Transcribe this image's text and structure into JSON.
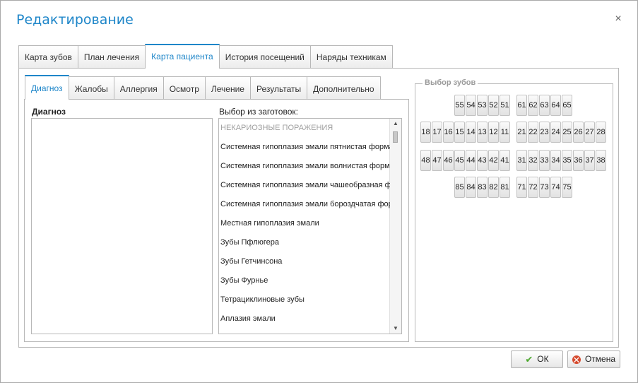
{
  "dialog": {
    "title": "Редактирование",
    "close_symbol": "×"
  },
  "outer_tabs": [
    {
      "label": "Карта зубов",
      "active": false
    },
    {
      "label": "План лечения",
      "active": false
    },
    {
      "label": "Карта пациента",
      "active": true
    },
    {
      "label": "История посещений",
      "active": false
    },
    {
      "label": "Наряды техникам",
      "active": false
    }
  ],
  "inner_tabs": [
    {
      "label": "Диагноз",
      "active": true
    },
    {
      "label": "Жалобы",
      "active": false
    },
    {
      "label": "Аллергия",
      "active": false
    },
    {
      "label": "Осмотр",
      "active": false
    },
    {
      "label": "Лечение",
      "active": false
    },
    {
      "label": "Результаты",
      "active": false
    },
    {
      "label": "Дополнительно",
      "active": false
    }
  ],
  "diagnosis": {
    "label": "Диагноз",
    "value": ""
  },
  "templates": {
    "label": "Выбор из заготовок:",
    "items": [
      {
        "text": "НЕКАРИОЗНЫЕ ПОРАЖЕНИЯ",
        "header": true
      },
      {
        "text": "Системная гипоплазия эмали пятнистая форма",
        "header": false
      },
      {
        "text": "Системная гипоплазия эмали волнистая форма",
        "header": false
      },
      {
        "text": "Системная гипоплазия эмали чашеобразная фо",
        "header": false
      },
      {
        "text": "Системная гипоплазия эмали бороздчатая фор",
        "header": false
      },
      {
        "text": "Местная гипоплазия эмали",
        "header": false
      },
      {
        "text": "Зубы Пфлюгера",
        "header": false
      },
      {
        "text": "Зубы Гетчинсона",
        "header": false
      },
      {
        "text": "Зубы Фурнье",
        "header": false
      },
      {
        "text": "Тетрациклиновые зубы",
        "header": false
      },
      {
        "text": "Аплазия эмали",
        "header": false
      }
    ]
  },
  "teeth": {
    "legend": "Выбор зубов",
    "upper_primary_right": [
      "55",
      "54",
      "53",
      "52",
      "51"
    ],
    "upper_primary_left": [
      "61",
      "62",
      "63",
      "64",
      "65"
    ],
    "upper_permanent_right": [
      "18",
      "17",
      "16",
      "15",
      "14",
      "13",
      "12",
      "11"
    ],
    "upper_permanent_left": [
      "21",
      "22",
      "23",
      "24",
      "25",
      "26",
      "27",
      "28"
    ],
    "lower_permanent_right": [
      "48",
      "47",
      "46",
      "45",
      "44",
      "43",
      "42",
      "41"
    ],
    "lower_permanent_left": [
      "31",
      "32",
      "33",
      "34",
      "35",
      "36",
      "37",
      "38"
    ],
    "lower_primary_right": [
      "85",
      "84",
      "83",
      "82",
      "81"
    ],
    "lower_primary_left": [
      "71",
      "72",
      "73",
      "74",
      "75"
    ]
  },
  "buttons": {
    "ok_label": "ОК",
    "cancel_label": "Отмена"
  },
  "icons": {
    "ok": "check-icon",
    "cancel": "cancel-icon",
    "close": "close-icon"
  },
  "colors": {
    "accent": "#1e86c9",
    "ok_icon": "#4ca82e",
    "cancel_icon": "#d64a2e"
  }
}
